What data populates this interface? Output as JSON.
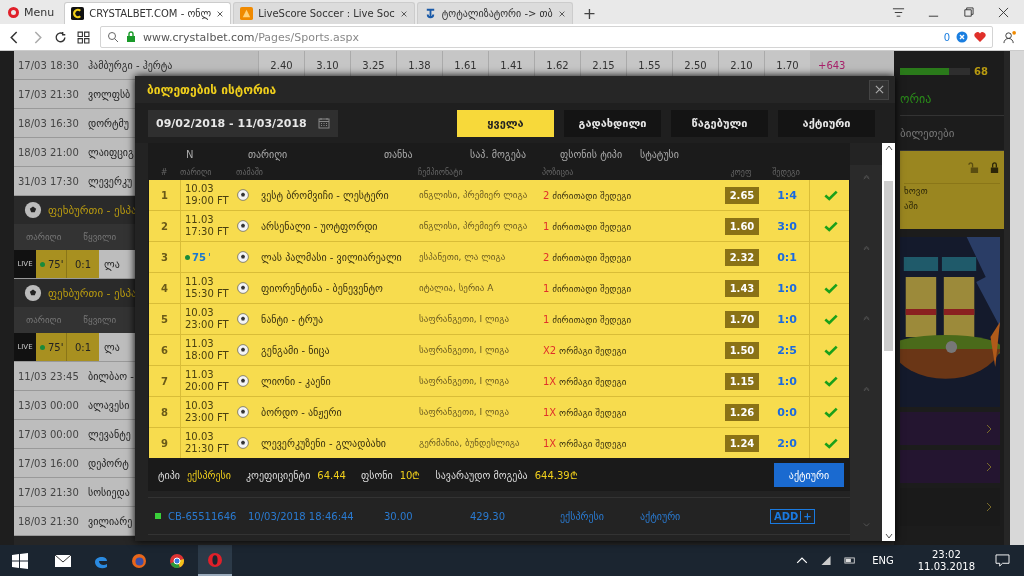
{
  "browser": {
    "menu": "Menu",
    "tabs": [
      {
        "title": "CRYSTALBET.COM - ონლ",
        "selected": true
      },
      {
        "title": "LiveScore Soccer : Live Soc",
        "selected": false
      },
      {
        "title": "ტოტალიზატორი -> თბ",
        "selected": false
      }
    ],
    "new_tab": "+",
    "address": {
      "host": "www.crystalbet.com",
      "path": "/Pages/Sports.aspx"
    },
    "badge_count": "0"
  },
  "page": {
    "top_row": {
      "date": "17/03 18:30",
      "match": "ჰამბურგი - ჰერტა",
      "odds": [
        "2.40",
        "3.10",
        "3.25",
        "1.38",
        "1.61",
        "1.41",
        "1.62",
        "2.15",
        "1.55",
        "2.50",
        "2.10",
        "1.70"
      ],
      "more": "+643"
    },
    "rows": [
      {
        "kind": "match",
        "date": "17/03 21:30",
        "match": "ვოლფსბ"
      },
      {
        "kind": "match",
        "date": "18/03 16:30",
        "match": "დორტმუ"
      },
      {
        "kind": "match",
        "date": "18/03 21:00",
        "match": "ლაიფციგ"
      },
      {
        "kind": "match",
        "date": "31/03 17:30",
        "match": "ლევერკუ"
      },
      {
        "kind": "section",
        "title": "ფეხბურთი - ესპა"
      },
      {
        "kind": "subheader",
        "col_1": "თარიღი",
        "col_2": "წყვილი"
      },
      {
        "kind": "live",
        "badge": "LIVE",
        "minute": "75'",
        "score": "0:1",
        "match": "ლა"
      },
      {
        "kind": "section",
        "title": "ფეხბურთი - ესპა"
      },
      {
        "kind": "subheader",
        "col_1": "თარიღი",
        "col_2": "წყვილი"
      },
      {
        "kind": "live",
        "badge": "LIVE",
        "minute": "75'",
        "score": "0:1",
        "match": "ლა"
      },
      {
        "kind": "match",
        "date": "11/03 23:45",
        "match": "ბილბაო -"
      },
      {
        "kind": "match",
        "date": "13/03 00:00",
        "match": "ალავესი"
      },
      {
        "kind": "match",
        "date": "17/03 00:00",
        "match": "ლევანტე"
      },
      {
        "kind": "match",
        "date": "17/03 16:00",
        "match": "დეპორტ"
      },
      {
        "kind": "match",
        "date": "17/03 21:30",
        "match": "სოსიედა"
      },
      {
        "kind": "match",
        "date": "18/03 21:30",
        "match": "ვილიარე"
      }
    ],
    "side": {
      "level": 0.7,
      "count": "68",
      "heading": "ორია",
      "link": "ბილეთები",
      "note_1": "ხოვთ",
      "note_2": "აში"
    }
  },
  "modal": {
    "title": "ბილეთების ისტორია",
    "date_range": "09/02/2018 - 11/03/2018",
    "filters": [
      {
        "label": "ყველა",
        "selected": true
      },
      {
        "label": "გადახდილი",
        "selected": false
      },
      {
        "label": "წაგებული",
        "selected": false
      },
      {
        "label": "აქტიური",
        "selected": false
      }
    ],
    "ticket_columns": [
      "N",
      "თარიღი",
      "თანხა",
      "საპ. მოგება",
      "ფსონის ტიპი",
      "სტატუსი"
    ],
    "bet_columns": [
      "#",
      "თარიღი",
      "თამაში",
      "ჩემპიონატი",
      "პოზიცია",
      "კოეფ",
      "შედეგი"
    ],
    "bets": [
      {
        "no": "1",
        "kind": "finished",
        "date": "10.03",
        "time": "19:00 FT",
        "match": "ვესტ ბრომვიჩი - ლესტერი",
        "league": "ინგლისი, პრემიერ ლიგა",
        "pick_code": "2",
        "pick": "ძირითადი შედეგი",
        "odds": "2.65",
        "score": "1:4",
        "won": true
      },
      {
        "no": "2",
        "kind": "finished",
        "date": "11.03",
        "time": "17:30 FT",
        "match": "არსენალი - უოტფორდი",
        "league": "ინგლისი, პრემიერ ლიგა",
        "pick_code": "1",
        "pick": "ძირითადი შედეგი",
        "odds": "1.60",
        "score": "3:0",
        "won": true
      },
      {
        "no": "3",
        "kind": "live",
        "time": "75",
        "mark": "'",
        "match": "ლას პალმასი - ვილიარეალი",
        "league": "ესპანეთი, ლა ლიგა",
        "pick_code": "2",
        "pick": "ძირითადი შედეგი",
        "odds": "2.32",
        "score": "0:1",
        "won": false
      },
      {
        "no": "4",
        "kind": "finished",
        "date": "11.03",
        "time": "15:30 FT",
        "match": "ფიორენტინა - ბენევენტო",
        "league": "იტალია, სერია A",
        "pick_code": "1",
        "pick": "ძირითადი შედეგი",
        "odds": "1.43",
        "score": "1:0",
        "won": true
      },
      {
        "no": "5",
        "kind": "finished",
        "date": "10.03",
        "time": "23:00 FT",
        "match": "ნანტი - ტრუა",
        "league": "საფრანგეთი, I ლიგა",
        "pick_code": "1",
        "pick": "ძირითადი შედეგი",
        "odds": "1.70",
        "score": "1:0",
        "won": true
      },
      {
        "no": "6",
        "kind": "finished",
        "date": "11.03",
        "time": "18:00 FT",
        "match": "გენგამი - ნიცა",
        "league": "საფრანგეთი, I ლიგა",
        "pick_code": "X2",
        "pick": "ორმაგი შედეგი",
        "odds": "1.50",
        "score": "2:5",
        "won": true
      },
      {
        "no": "7",
        "kind": "finished",
        "date": "11.03",
        "time": "20:00 FT",
        "match": "ლიონი - კაენი",
        "league": "საფრანგეთი, I ლიგა",
        "pick_code": "1X",
        "pick": "ორმაგი შედეგი",
        "odds": "1.15",
        "score": "1:0",
        "won": true
      },
      {
        "no": "8",
        "kind": "finished",
        "date": "10.03",
        "time": "23:00 FT",
        "match": "ბორდო - ანჟერი",
        "league": "საფრანგეთი, I ლიგა",
        "pick_code": "1X",
        "pick": "ორმაგი შედეგი",
        "odds": "1.26",
        "score": "0:0",
        "won": true
      },
      {
        "no": "9",
        "kind": "finished",
        "date": "10.03",
        "time": "21:30 FT",
        "match": "ლევერკუზენი - გლადბახი",
        "league": "გერმანია, ბუნდესლიგა",
        "pick_code": "1X",
        "pick": "ორმაგი შედეგი",
        "odds": "1.24",
        "score": "2:0",
        "won": true
      }
    ],
    "summary": [
      {
        "label": "ტიპი",
        "value": "ექსპრესი"
      },
      {
        "label": "კოეფიციენტი",
        "value": "64.44"
      },
      {
        "label": "ფსონი",
        "value": "10₾"
      },
      {
        "label": "სავარაუდო მოგება",
        "value": "644.39₾"
      }
    ],
    "status_button": "აქტიური",
    "ticket": {
      "active": true,
      "id": "CB-65511646",
      "date": "10/03/2018 18:46:44",
      "amount": "30.00",
      "win": "429.30",
      "type": "ექსპრესი",
      "status": "აქტიური",
      "add": "ADD",
      "plus": "+"
    }
  },
  "taskbar": {
    "apps": [
      {
        "kind": "mail",
        "selected": false
      },
      {
        "kind": "edge",
        "selected": false
      },
      {
        "kind": "firefox",
        "selected": false
      },
      {
        "kind": "chrome",
        "selected": false
      },
      {
        "kind": "opera",
        "selected": true
      }
    ],
    "language": "ENG",
    "time": "23:02",
    "date": "11.03.2018"
  }
}
